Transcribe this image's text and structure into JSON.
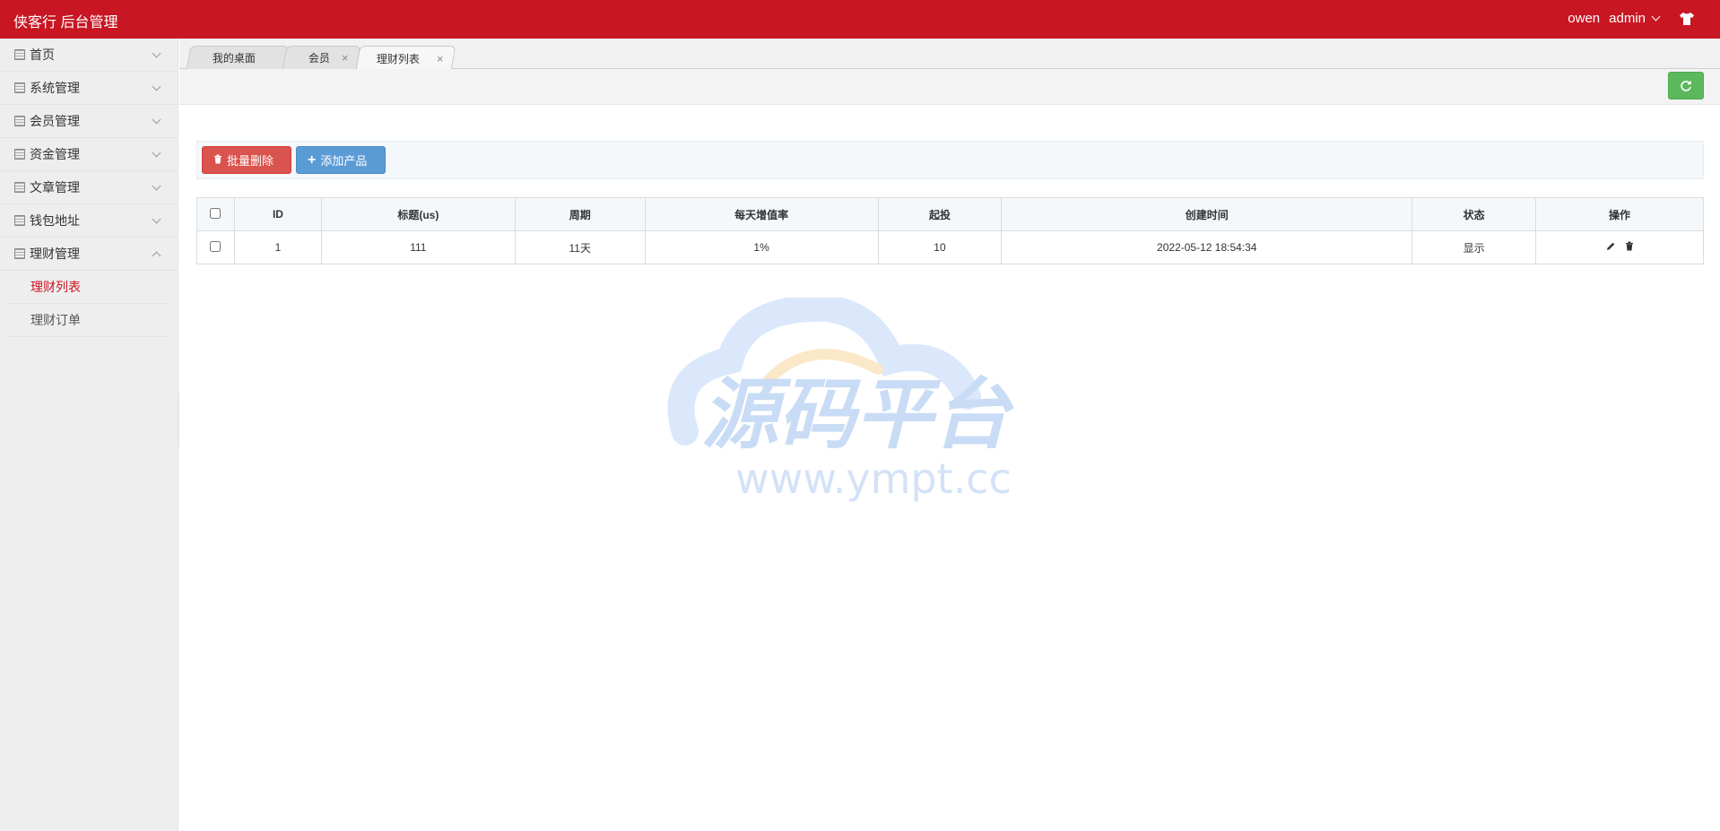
{
  "header": {
    "brand": "侠客行 后台管理",
    "user_name": "owen",
    "role": "admin",
    "accent_color": "#c81623"
  },
  "sidebar": {
    "items": [
      {
        "label": "首页",
        "icon": "grid-icon",
        "expanded": false
      },
      {
        "label": "系统管理",
        "icon": "grid-icon",
        "expanded": false
      },
      {
        "label": "会员管理",
        "icon": "grid-icon",
        "expanded": false
      },
      {
        "label": "资金管理",
        "icon": "grid-icon",
        "expanded": false
      },
      {
        "label": "文章管理",
        "icon": "grid-icon",
        "expanded": false
      },
      {
        "label": "钱包地址",
        "icon": "grid-icon",
        "expanded": false
      },
      {
        "label": "理财管理",
        "icon": "grid-icon",
        "expanded": true
      }
    ],
    "subitems": [
      {
        "label": "理财列表",
        "active": true
      },
      {
        "label": "理财订单",
        "active": false
      }
    ]
  },
  "tabs": [
    {
      "label": "我的桌面",
      "closable": false
    },
    {
      "label": "会员",
      "closable": true
    },
    {
      "label": "理财列表",
      "closable": true,
      "active": true
    }
  ],
  "toolbar": {
    "batch_delete_label": "批量删除",
    "add_product_label": "添加产品"
  },
  "table": {
    "columns": [
      "ID",
      "标题(us)",
      "周期",
      "每天增值率",
      "起投",
      "创建时间",
      "状态",
      "操作"
    ],
    "rows": [
      {
        "id": "1",
        "title": "111",
        "period": "11天",
        "daily_rate": "1%",
        "min_invest": "10",
        "created": "2022-05-12 18:54:34",
        "status": "显示"
      }
    ]
  },
  "watermark": {
    "title": "源码平台",
    "url": "www.ympt.cc"
  }
}
